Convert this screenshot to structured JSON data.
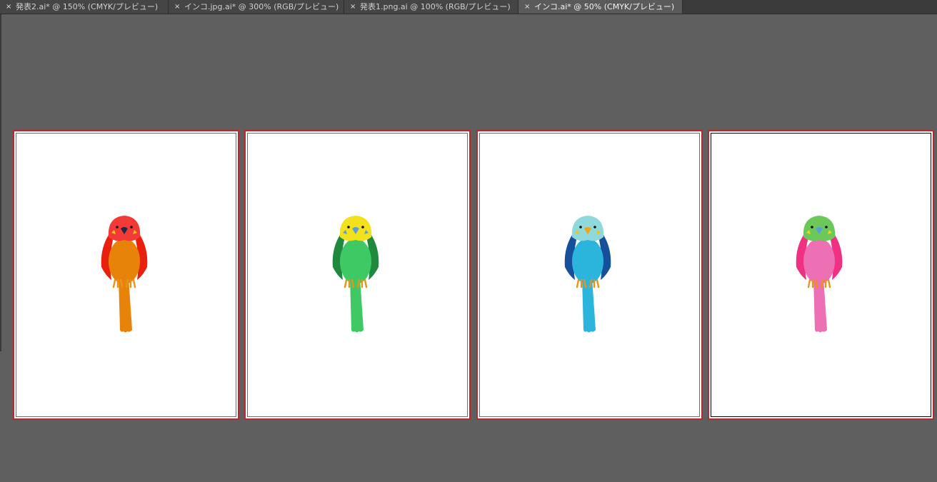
{
  "tabs": [
    {
      "label": "発表2.ai* @ 150% (CMYK/プレビュー)",
      "close": "×"
    },
    {
      "label": "インコ.jpg.ai* @ 300% (RGB/プレビュー)",
      "close": "×"
    },
    {
      "label": "発表1.png.ai @ 100% (RGB/プレビュー)",
      "close": "×"
    },
    {
      "label": "インコ.ai* @ 50% (CMYK/プレビュー)",
      "close": "×"
    }
  ],
  "active_tab_index": 3,
  "birds": [
    {
      "head": "#f33a36",
      "cheek_mark": "#f1c40f",
      "body": "#e8830a",
      "wing": "#e8200c",
      "tail": "#e8830a",
      "beak": "#1e2a4a",
      "feet": "#e8941c"
    },
    {
      "head": "#f2e11c",
      "cheek_mark": "#5b9fd6",
      "body": "#3ec964",
      "wing": "#1f8a3d",
      "tail": "#3ec964",
      "beak": "#5b9fd6",
      "feet": "#e8941c"
    },
    {
      "head": "#8fd8dc",
      "cheek_mark": "#f1c40f",
      "body": "#2bb5dd",
      "wing": "#16509a",
      "tail": "#2bb5dd",
      "beak": "#f2a31a",
      "feet": "#e8941c"
    },
    {
      "head": "#6cc85a",
      "cheek_mark": "#f1d21c",
      "body": "#ec70b3",
      "wing": "#f03080",
      "tail": "#ec70b3",
      "beak": "#5b9fd6",
      "feet": "#e8941c"
    }
  ]
}
